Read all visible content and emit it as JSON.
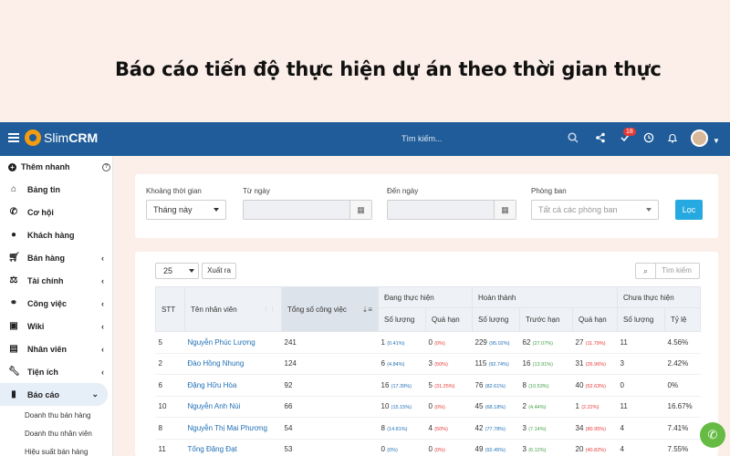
{
  "banner": {
    "title": "Báo cáo tiến độ thực hiện dự án theo thời gian thực"
  },
  "topbar": {
    "brand_light": "Slim",
    "brand_bold": "CRM",
    "search_placeholder": "Tìm kiếm...",
    "notification_count": "18"
  },
  "sidebar": {
    "quick_add": "Thêm nhanh",
    "items": [
      {
        "label": "Bảng tin",
        "icon": "home-icon"
      },
      {
        "label": "Cơ hội",
        "icon": "phone-icon"
      },
      {
        "label": "Khách hàng",
        "icon": "user-icon"
      },
      {
        "label": "Bán hàng",
        "icon": "cart-icon"
      },
      {
        "label": "Tài chính",
        "icon": "scale-icon"
      },
      {
        "label": "Công việc",
        "icon": "handshake-icon"
      },
      {
        "label": "Wiki",
        "icon": "wiki-icon"
      },
      {
        "label": "Nhân viên",
        "icon": "id-card-icon"
      },
      {
        "label": "Tiện ích",
        "icon": "wrench-icon"
      },
      {
        "label": "Báo cáo",
        "icon": "bar-chart-icon"
      }
    ],
    "sub_items": [
      "Doanh thu bán hàng",
      "Doanh thu nhân viên",
      "Hiệu suất bán hàng"
    ]
  },
  "filters": {
    "period_label": "Khoảng thời gian",
    "period_value": "Tháng này",
    "from_label": "Từ ngày",
    "to_label": "Đến ngày",
    "department_label": "Phòng ban",
    "department_value": "Tất cả các phòng ban",
    "filter_button": "Lọc"
  },
  "table": {
    "page_size": "25",
    "export_button": "Xuất ra",
    "search_placeholder": "Tìm kiếm",
    "headers": {
      "stt": "STT",
      "employee": "Tên nhân viên",
      "total": "Tổng số công việc",
      "in_progress": "Đang thực hiện",
      "completed": "Hoàn thành",
      "not_done": "Chưa thực hiện",
      "qty": "Số lượng",
      "overdue": "Quá hạn",
      "early": "Trước hạn",
      "ratio": "Tỷ lệ"
    },
    "rows": [
      {
        "stt": "5",
        "name": "Nguyễn Phúc Lượng",
        "total": "241",
        "ip_qty": "1",
        "ip_qty_pct": "(0.41%)",
        "ip_over": "0",
        "ip_over_pct": "(0%)",
        "c_qty": "229",
        "c_qty_pct": "(95.02%)",
        "c_early": "62",
        "c_early_pct": "(27.07%)",
        "c_over": "27",
        "c_over_pct": "(11.79%)",
        "nd_qty": "11",
        "nd_ratio": "4.56%"
      },
      {
        "stt": "2",
        "name": "Đào Hồng Nhung",
        "total": "124",
        "ip_qty": "6",
        "ip_qty_pct": "(4.84%)",
        "ip_over": "3",
        "ip_over_pct": "(50%)",
        "c_qty": "115",
        "c_qty_pct": "(92.74%)",
        "c_early": "16",
        "c_early_pct": "(13.91%)",
        "c_over": "31",
        "c_over_pct": "(26.96%)",
        "nd_qty": "3",
        "nd_ratio": "2.42%"
      },
      {
        "stt": "6",
        "name": "Đặng Hữu Hòa",
        "total": "92",
        "ip_qty": "16",
        "ip_qty_pct": "(17.39%)",
        "ip_over": "5",
        "ip_over_pct": "(31.25%)",
        "c_qty": "76",
        "c_qty_pct": "(82.61%)",
        "c_early": "8",
        "c_early_pct": "(10.53%)",
        "c_over": "40",
        "c_over_pct": "(52.63%)",
        "nd_qty": "0",
        "nd_ratio": "0%"
      },
      {
        "stt": "10",
        "name": "Nguyễn Anh Nùi",
        "total": "66",
        "ip_qty": "10",
        "ip_qty_pct": "(15.15%)",
        "ip_over": "0",
        "ip_over_pct": "(0%)",
        "c_qty": "45",
        "c_qty_pct": "(68.18%)",
        "c_early": "2",
        "c_early_pct": "(4.44%)",
        "c_over": "1",
        "c_over_pct": "(2.22%)",
        "nd_qty": "11",
        "nd_ratio": "16.67%"
      },
      {
        "stt": "8",
        "name": "Nguyễn Thị Mai Phương",
        "total": "54",
        "ip_qty": "8",
        "ip_qty_pct": "(14.81%)",
        "ip_over": "4",
        "ip_over_pct": "(50%)",
        "c_qty": "42",
        "c_qty_pct": "(77.78%)",
        "c_early": "3",
        "c_early_pct": "(7.14%)",
        "c_over": "34",
        "c_over_pct": "(80.95%)",
        "nd_qty": "4",
        "nd_ratio": "7.41%"
      },
      {
        "stt": "11",
        "name": "Tống Đặng Đạt",
        "total": "53",
        "ip_qty": "0",
        "ip_qty_pct": "(0%)",
        "ip_over": "0",
        "ip_over_pct": "(0%)",
        "c_qty": "49",
        "c_qty_pct": "(92.45%)",
        "c_early": "3",
        "c_early_pct": "(6.12%)",
        "c_over": "20",
        "c_over_pct": "(40.82%)",
        "nd_qty": "4",
        "nd_ratio": "7.55%"
      }
    ]
  }
}
